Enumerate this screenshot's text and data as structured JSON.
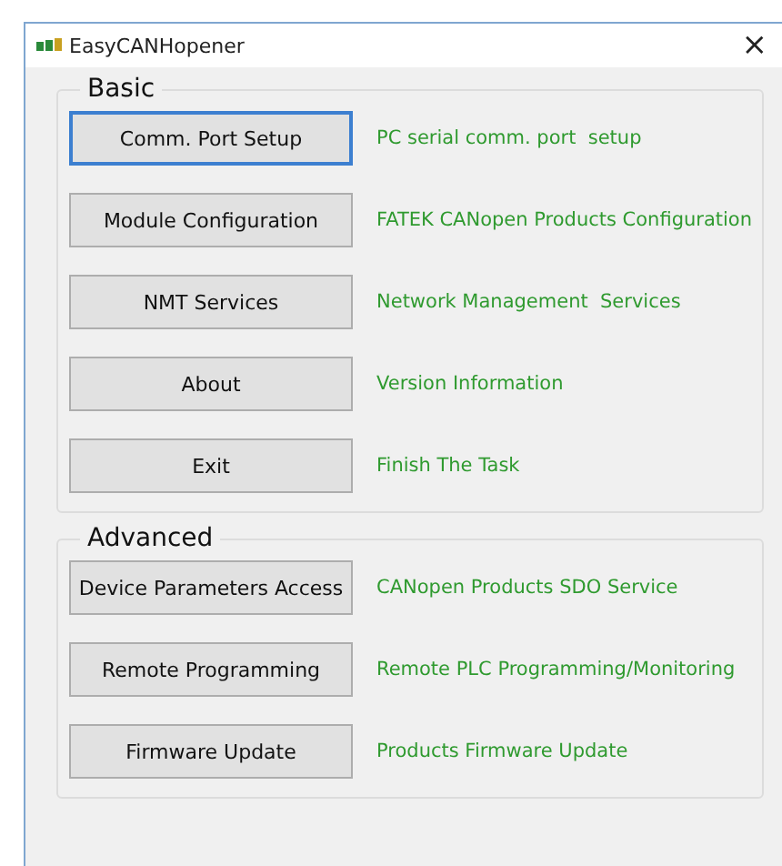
{
  "window": {
    "title": "EasyCANHopener",
    "close": "×"
  },
  "groups": [
    {
      "title": "Basic",
      "items": [
        {
          "button": "Comm. Port Setup",
          "description": "PC serial comm. port  setup",
          "focused": true
        },
        {
          "button": "Module Configuration",
          "description": "FATEK CANopen Products Configuration",
          "focused": false
        },
        {
          "button": "NMT Services",
          "description": "Network Management  Services",
          "focused": false
        },
        {
          "button": "About",
          "description": "Version Information",
          "focused": false
        },
        {
          "button": "Exit",
          "description": "Finish The Task",
          "focused": false
        }
      ]
    },
    {
      "title": "Advanced",
      "items": [
        {
          "button": "Device Parameters Access",
          "description": "CANopen Products SDO Service",
          "focused": false
        },
        {
          "button": "Remote Programming",
          "description": "Remote PLC Programming/Monitoring",
          "focused": false
        },
        {
          "button": "Firmware Update",
          "description": "Products Firmware Update",
          "focused": false
        }
      ]
    }
  ]
}
